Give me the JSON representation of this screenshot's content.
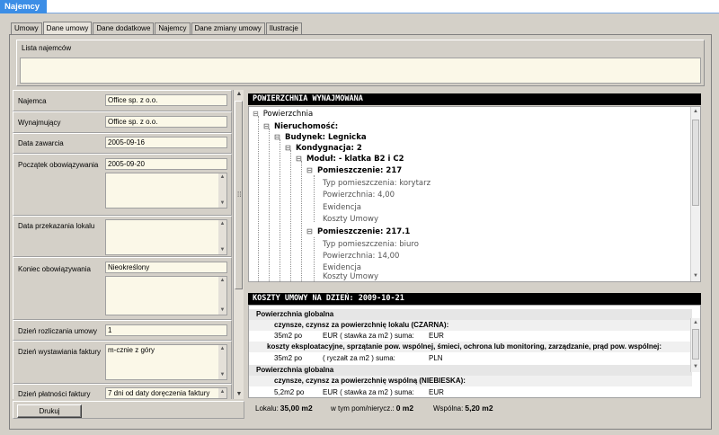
{
  "window": {
    "title": "Najemcy"
  },
  "tabs": [
    {
      "label": "Umowy"
    },
    {
      "label": "Dane umowy",
      "active": true
    },
    {
      "label": "Dane dodatkowe"
    },
    {
      "label": "Najemcy"
    },
    {
      "label": "Dane zmiany umowy"
    },
    {
      "label": "Ilustracje"
    }
  ],
  "lista": {
    "label": "Lista najemców",
    "value": ""
  },
  "form": {
    "najemca": {
      "label": "Najemca",
      "value": "Office sp. z o.o."
    },
    "wynajmujacy": {
      "label": "Wynajmujący",
      "value": "Office sp. z o.o."
    },
    "data_zawarcia": {
      "label": "Data zawarcia",
      "value": "2005-09-16"
    },
    "poczatek": {
      "label": "Początek obowiązywania",
      "value": "2005-09-20"
    },
    "data_przekazania": {
      "label": "Data przekazania lokalu",
      "value": ""
    },
    "koniec": {
      "label": "Koniec obowiązywania",
      "value": "Nieokreślony"
    },
    "dzien_rozliczania": {
      "label": "Dzień rozliczania umowy",
      "value": "1"
    },
    "dzien_wystawiania": {
      "label": "Dzień wystawiania faktury",
      "value": "m-cznie z góry"
    },
    "dzien_platnosci": {
      "label": "Dzień płatności faktury",
      "value": "7 dni od daty doręczenia faktury"
    }
  },
  "buttons": {
    "drukuj": "Drukuj"
  },
  "powierzchnia": {
    "header": "POWIERZCHNIA WYNAJMOWANA",
    "tree": [
      {
        "text": "Powierzchnia",
        "bold": false
      },
      {
        "text": "Nieruchomość:",
        "bold": true
      },
      {
        "text": "Budynek: Legnicka",
        "bold": true
      },
      {
        "text": "Kondygnacja: 2",
        "bold": true
      },
      {
        "text": "Moduł: - klatka B2 i C2",
        "bold": true
      },
      {
        "text": "Pomieszczenie: 217",
        "bold": true
      },
      {
        "text": "Typ pomieszczenia: korytarz",
        "bold": false
      },
      {
        "text": "Powierzchnia: 4,00",
        "bold": false
      },
      {
        "text": "Ewidencja",
        "bold": false
      },
      {
        "text": "Koszty Umowy",
        "bold": false
      },
      {
        "text": "Pomieszczenie: 217.1",
        "bold": true
      },
      {
        "text": "Typ pomieszczenia: biuro",
        "bold": false
      },
      {
        "text": "Powierzchnia: 14,00",
        "bold": false
      },
      {
        "text": "Ewidencja",
        "bold": false
      },
      {
        "text": "Koszty Umowy",
        "bold": false
      }
    ]
  },
  "koszty": {
    "header": "KOSZTY UMOWY NA DZIEŃ: 2009-10-21",
    "rows": [
      {
        "kind": "h1",
        "text": "Powierzchnia globalna"
      },
      {
        "kind": "h2",
        "text": "czynsze, czynsz za powierzchnię lokalu (CZARNA):"
      },
      {
        "kind": "d",
        "a": "35m2 po",
        "b": "EUR ( stawka za m2 ) suma:",
        "c": "EUR"
      },
      {
        "kind": "h2k",
        "text": "koszty eksploatacyjne, sprzątanie pow. wspólnej, śmieci, ochrona lub monitoring, zarządzanie, prąd pow. wspólnej:"
      },
      {
        "kind": "d",
        "a": "35m2 po",
        "b": "( ryczałt za m2 ) suma:",
        "c": "PLN"
      },
      {
        "kind": "h1",
        "text": "Powierzchnia  globalna"
      },
      {
        "kind": "h2",
        "text": "czynsze, czynsz za powierzchnię wspólną (NIEBIESKA):"
      },
      {
        "kind": "d",
        "a": "5,2m2 po",
        "b": "EUR ( stawka za m2 ) suma:",
        "c": "EUR"
      }
    ]
  },
  "summary": {
    "lokalu_label": "Lokalu:",
    "lokalu_value": "35,00 m2",
    "pom_label": "w tym pom/nierycz.:",
    "pom_value": "0 m2",
    "wspolna_label": "Wspólna:",
    "wspolna_value": "5,20 m2"
  }
}
